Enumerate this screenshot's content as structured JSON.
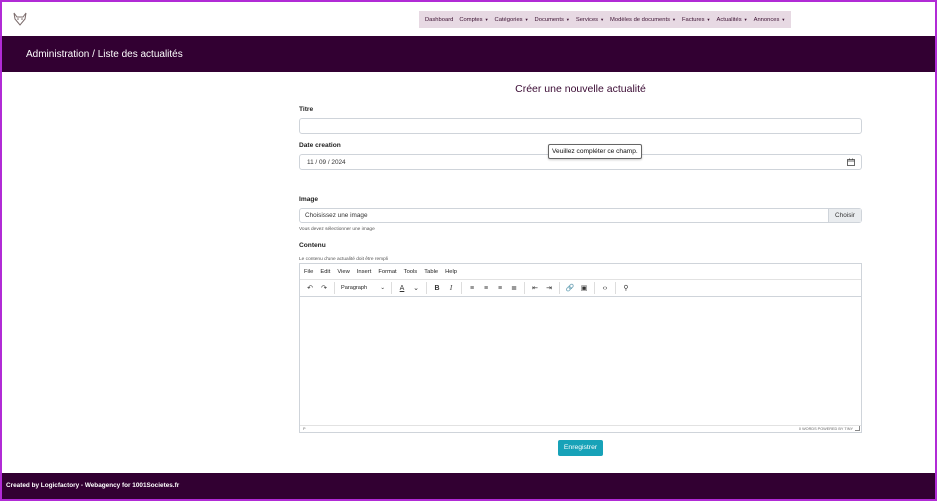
{
  "colors": {
    "brand": "#320032",
    "accent": "#17a2b8",
    "nav_bg": "#e7d9e3",
    "frame": "#b12bd6"
  },
  "logo": {
    "icon": "fox-logo-icon"
  },
  "nav": {
    "items": [
      {
        "label": "Dashboard",
        "dropdown": false
      },
      {
        "label": "Comptes",
        "dropdown": true
      },
      {
        "label": "Catégories",
        "dropdown": true
      },
      {
        "label": "Documents",
        "dropdown": true
      },
      {
        "label": "Services",
        "dropdown": true
      },
      {
        "label": "Modèles de documents",
        "dropdown": true
      },
      {
        "label": "Factures",
        "dropdown": true
      },
      {
        "label": "Actualités",
        "dropdown": true
      },
      {
        "label": "Annonces",
        "dropdown": true
      }
    ]
  },
  "header": {
    "title": "Administration / Liste des actualités"
  },
  "form": {
    "title": "Créer une nouvelle actualité",
    "titre_label": "Titre",
    "titre_value": "",
    "date_label": "Date creation",
    "date_value": "11 / 09 / 2024",
    "tooltip": "Veuillez compléter ce champ.",
    "image_label": "Image",
    "image_placeholder": "Choisissez une image",
    "image_button": "Choisir",
    "image_help": "Vous devez sélectionner une image",
    "contenu_label": "Contenu",
    "contenu_help": "Le contenu d'une actualité doit être rempli",
    "save_label": "Enregistrer"
  },
  "editor": {
    "menu": [
      "File",
      "Edit",
      "View",
      "Insert",
      "Format",
      "Tools",
      "Table",
      "Help"
    ],
    "paragraph": "Paragraph",
    "status_left": "P",
    "status_right": "0 WORDS  POWERED BY TINY"
  },
  "footer": {
    "text": "Created by Logicfactory - Webagency for 1001Societes.fr"
  }
}
